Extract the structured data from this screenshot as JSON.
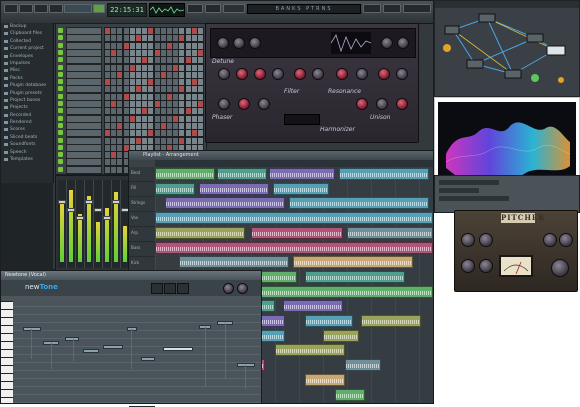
{
  "fl_main": {
    "time_display": "22:15:31",
    "pattern_strip": "BANKS PTRNS"
  },
  "browser": {
    "items": [
      "Backup",
      "Clipboard files",
      "Collected",
      "Current project",
      "Envelopes",
      "Impulses",
      "Misc",
      "Packs",
      "Plugin database",
      "Plugin presets",
      "Project bones",
      "Projects",
      "Recorded",
      "Rendered",
      "Scores",
      "Sliced beats",
      "Soundfonts",
      "Speech",
      "Templates"
    ]
  },
  "synth": {
    "labels": [
      "Filter",
      "Resonance",
      "Harmonizer",
      "Detune",
      "Phaser",
      "Unison"
    ]
  },
  "playlist": {
    "title": "Playlist - Arrangement",
    "tracks": [
      "Beat",
      "Fill",
      "Strings",
      "Vox",
      "Arp",
      "Bass",
      "Kick",
      "Pad",
      "FX",
      "Lead",
      "Piano",
      "Bell",
      "Noise",
      "Sub",
      "Perc",
      "Riser"
    ]
  },
  "pitcher": {
    "title": "PITCHER"
  },
  "newtone": {
    "window_title": "Newtone (Vocal)",
    "logo_prefix": "new",
    "logo_suffix": "Tone"
  },
  "colors": {
    "accent_green": "#76c83a",
    "accent_red": "#d33b3b",
    "accent_blue": "#37a8ea"
  }
}
